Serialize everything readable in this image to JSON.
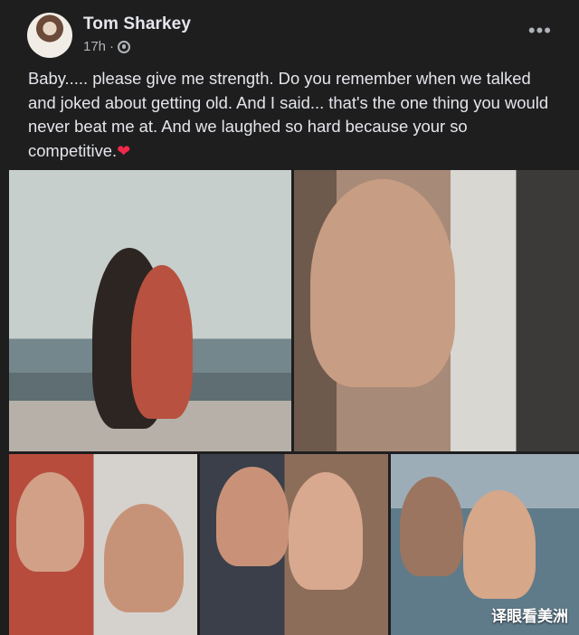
{
  "post": {
    "author_name": "Tom Sharkey",
    "timestamp": "17h",
    "separator": "·",
    "privacy_icon": "globe-icon",
    "more_label": "•••",
    "text": "Baby..... please give me strength. Do you remember when we talked and joked about getting old. And I said... that's the one thing you would never beat me at. And we laughed so hard because your so competitive.",
    "emoji": "❤"
  },
  "photos": {
    "count": 5
  },
  "watermark": "译眼看美洲",
  "colors": {
    "background": "#1e1e1f",
    "text": "#e4e6eb",
    "secondary_text": "#b0b3b8",
    "heart": "#f0284a"
  }
}
